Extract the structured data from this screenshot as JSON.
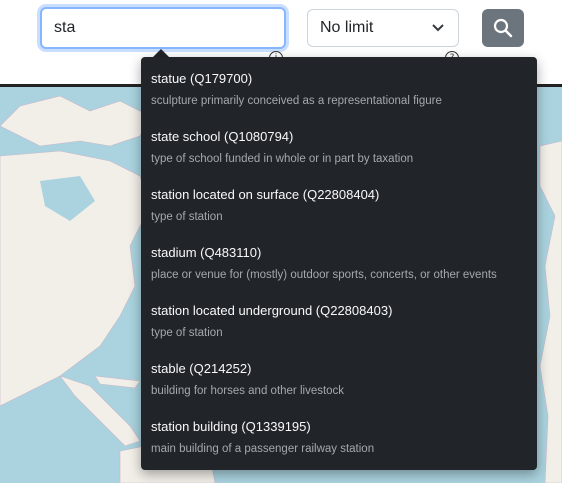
{
  "search": {
    "value": "sta",
    "placeholder": ""
  },
  "limit": {
    "selected": "No limit"
  },
  "hints": [
    "i",
    "?"
  ],
  "icons": {
    "search": "search-icon",
    "chevron": "chevron-down-icon"
  },
  "colors": {
    "dropdown_bg": "#212529",
    "button_bg": "#6c757d",
    "focus_border": "#86b7fe",
    "water": "#aad3df",
    "land": "#f2efe9"
  },
  "suggestions": [
    {
      "label": "statue (Q179700)",
      "description": "sculpture primarily conceived as a representational figure"
    },
    {
      "label": "state school (Q1080794)",
      "description": "type of school funded in whole or in part by taxation"
    },
    {
      "label": "station located on surface (Q22808404)",
      "description": "type of station"
    },
    {
      "label": "stadium (Q483110)",
      "description": "place or venue for (mostly) outdoor sports, concerts, or other events"
    },
    {
      "label": "station located underground (Q22808403)",
      "description": "type of station"
    },
    {
      "label": "stable (Q214252)",
      "description": "building for horses and other livestock"
    },
    {
      "label": "station building (Q1339195)",
      "description": "main building of a passenger railway station"
    }
  ]
}
